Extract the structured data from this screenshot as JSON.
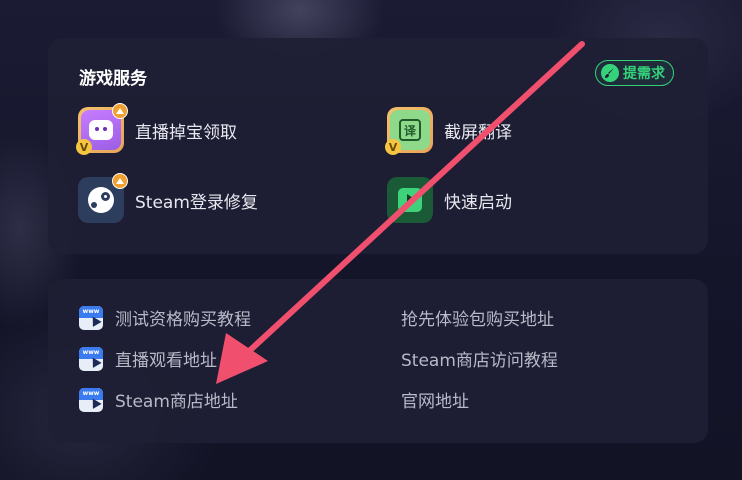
{
  "services_card": {
    "title": "游戏服务",
    "request_button": "提需求",
    "items": [
      {
        "label": "直播掉宝领取",
        "icon": "live-drop-icon",
        "badge": "V"
      },
      {
        "label": "截屏翻译",
        "icon": "screenshot-translate-icon",
        "badge": "V",
        "icon_glyph": "译"
      },
      {
        "label": "Steam登录修复",
        "icon": "steam-icon"
      },
      {
        "label": "快速启动",
        "icon": "quick-launch-icon"
      }
    ]
  },
  "links_card": {
    "icon_text": "www",
    "items": [
      {
        "label": "测试资格购买教程"
      },
      {
        "label": "抢先体验包购买地址"
      },
      {
        "label": "直播观看地址"
      },
      {
        "label": "Steam商店访问教程"
      },
      {
        "label": "Steam商店地址"
      },
      {
        "label": "官网地址"
      }
    ]
  },
  "colors": {
    "accent_green": "#34d27a",
    "annotation_arrow": "#f0506e"
  }
}
